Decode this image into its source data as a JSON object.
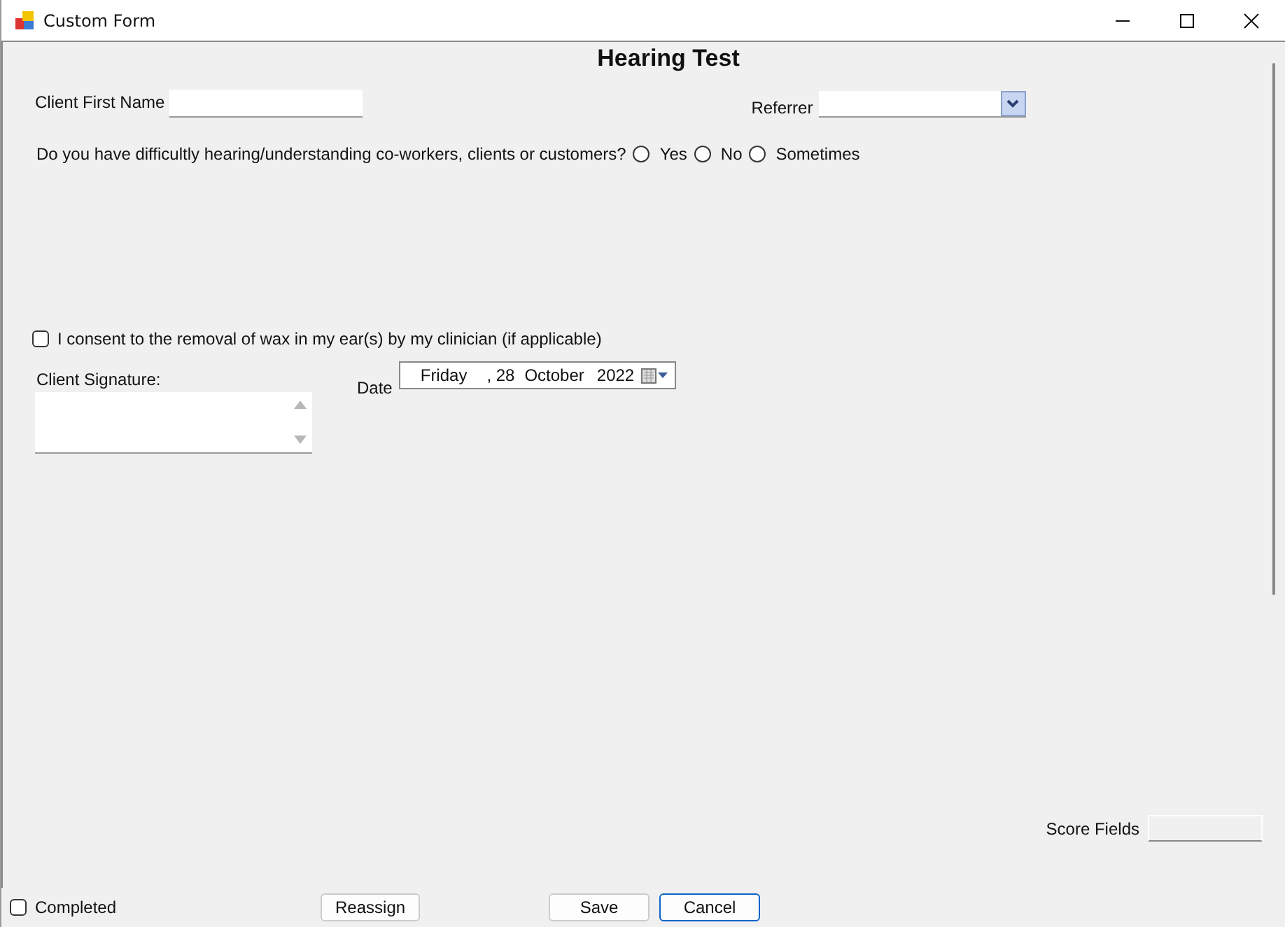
{
  "window": {
    "title": "Custom Form"
  },
  "form": {
    "heading": "Hearing Test",
    "first_name": {
      "label": "Client First Name"
    },
    "referrer": {
      "label": "Referrer"
    },
    "question": {
      "text": "Do you have difficultly hearing/understanding co-workers, clients or customers?",
      "options": [
        {
          "label": "Yes",
          "selected": false
        },
        {
          "label": "No",
          "selected": false
        },
        {
          "label": "Sometimes",
          "selected": false
        }
      ]
    },
    "consent": {
      "label": "I consent to the removal of wax in my ear(s) by my clinician (if applicable)",
      "checked": false
    },
    "signature": {
      "label": "Client Signature:"
    },
    "date": {
      "label": "Date",
      "parts": [
        "Friday",
        ", 28",
        "October",
        "2022"
      ]
    },
    "score_fields": {
      "label": "Score Fields"
    }
  },
  "footer": {
    "completed": {
      "label": "Completed",
      "checked": false
    },
    "buttons": [
      {
        "label": "Reassign",
        "focused": false
      },
      {
        "label": "Save",
        "focused": false
      },
      {
        "label": "Cancel",
        "focused": true
      }
    ]
  }
}
